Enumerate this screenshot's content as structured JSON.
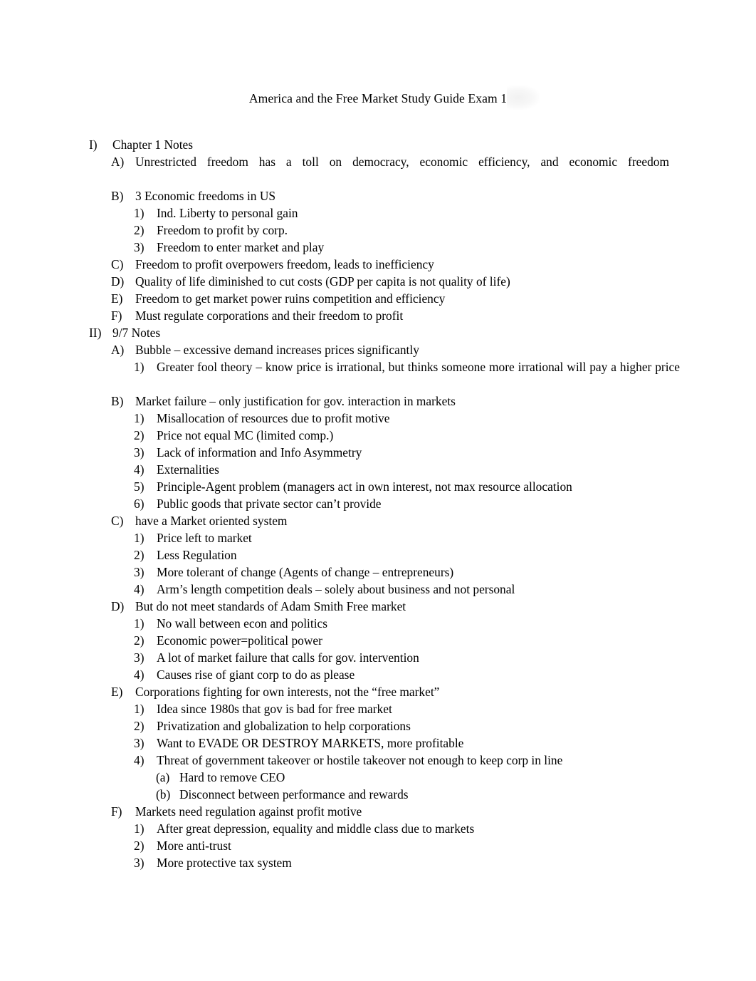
{
  "document": {
    "title": "America and the Free Market Study Guide Exam 1",
    "page_background": "#ffffff",
    "text_color": "#000000"
  },
  "outline": [
    {
      "level": 1,
      "marker": "I)",
      "text": "Chapter 1 Notes"
    },
    {
      "level": 2,
      "marker": "A)",
      "text": "Unrestricted freedom has a toll on democracy, economic efficiency, and economic freedom",
      "justified": true
    },
    {
      "level": 2,
      "marker": "B)",
      "text": "3 Economic freedoms in US"
    },
    {
      "level": 3,
      "marker": "1)",
      "text": "Ind. Liberty to personal gain"
    },
    {
      "level": 3,
      "marker": "2)",
      "text": "Freedom to profit by corp."
    },
    {
      "level": 3,
      "marker": "3)",
      "text": "Freedom to enter market and play"
    },
    {
      "level": 2,
      "marker": "C)",
      "text": "Freedom to profit overpowers freedom, leads to inefficiency"
    },
    {
      "level": 2,
      "marker": "D)",
      "text": "Quality of life diminished to cut costs (GDP per capita is not quality of life)"
    },
    {
      "level": 2,
      "marker": "E)",
      "text": "Freedom to get market power ruins competition and efficiency"
    },
    {
      "level": 2,
      "marker": "F)",
      "text": "Must regulate corporations and their freedom to profit"
    },
    {
      "level": 1,
      "marker": "II)",
      "text": "9/7 Notes"
    },
    {
      "level": 2,
      "marker": "A)",
      "text": "Bubble – excessive demand increases prices significantly"
    },
    {
      "level": 3,
      "marker": "1)",
      "text": "Greater fool theory – know price is irrational, but thinks someone more irrational will pay a higher price",
      "justified": true
    },
    {
      "level": 2,
      "marker": "B)",
      "text": "Market failure – only justification for gov. interaction in markets"
    },
    {
      "level": 3,
      "marker": "1)",
      "text": "Misallocation of resources due to profit motive"
    },
    {
      "level": 3,
      "marker": "2)",
      "text": "Price not equal MC (limited comp.)"
    },
    {
      "level": 3,
      "marker": "3)",
      "text": "Lack of information and Info Asymmetry"
    },
    {
      "level": 3,
      "marker": "4)",
      "text": "Externalities"
    },
    {
      "level": 3,
      "marker": "5)",
      "text": "Principle-Agent problem (managers act in own interest, not max resource allocation"
    },
    {
      "level": 3,
      "marker": "6)",
      "text": "Public goods that private sector can’t provide"
    },
    {
      "level": 2,
      "marker": "C)",
      "text": "have a Market oriented system"
    },
    {
      "level": 3,
      "marker": "1)",
      "text": "Price left to market"
    },
    {
      "level": 3,
      "marker": "2)",
      "text": "Less Regulation"
    },
    {
      "level": 3,
      "marker": "3)",
      "text": "More tolerant of change (Agents of change – entrepreneurs)"
    },
    {
      "level": 3,
      "marker": "4)",
      "text": "Arm’s length competition deals – solely about business and not personal"
    },
    {
      "level": 2,
      "marker": "D)",
      "text": "But do not meet standards of Adam Smith Free market"
    },
    {
      "level": 3,
      "marker": "1)",
      "text": "No wall between econ and politics"
    },
    {
      "level": 3,
      "marker": "2)",
      "text": "Economic power=political power"
    },
    {
      "level": 3,
      "marker": "3)",
      "text": "A lot of market failure that calls for gov. intervention"
    },
    {
      "level": 3,
      "marker": "4)",
      "text": "Causes rise of giant corp to do as please"
    },
    {
      "level": 2,
      "marker": "E)",
      "text": "Corporations fighting for own interests, not the “free market”"
    },
    {
      "level": 3,
      "marker": "1)",
      "text": "Idea since 1980s that gov is bad for free market"
    },
    {
      "level": 3,
      "marker": "2)",
      "text": "Privatization and globalization to help corporations"
    },
    {
      "level": 3,
      "marker": "3)",
      "text": "Want to EVADE OR DESTROY MARKETS, more profitable"
    },
    {
      "level": 3,
      "marker": "4)",
      "text": "Threat of government takeover or hostile takeover not enough to keep corp in line"
    },
    {
      "level": 4,
      "marker": "(a)",
      "text": "Hard to remove CEO"
    },
    {
      "level": 4,
      "marker": "(b)",
      "text": "Disconnect between performance and rewards"
    },
    {
      "level": 2,
      "marker": "F)",
      "text": "Markets need regulation against profit motive"
    },
    {
      "level": 3,
      "marker": "1)",
      "text": "After great depression, equality and middle class due to markets"
    },
    {
      "level": 3,
      "marker": "2)",
      "text": "More anti-trust"
    },
    {
      "level": 3,
      "marker": "3)",
      "text": "More protective tax system"
    }
  ]
}
